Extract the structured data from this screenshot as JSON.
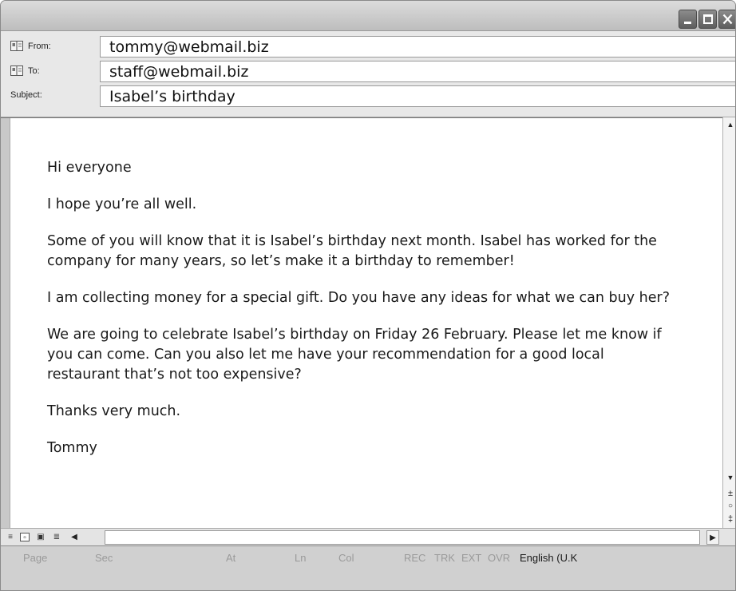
{
  "header": {
    "from_label": "From:",
    "from_value": "tommy@webmail.biz",
    "to_label": "To:",
    "to_value": "staff@webmail.biz",
    "subject_label": "Subject:",
    "subject_value": "Isabel’s birthday"
  },
  "message": {
    "paragraphs": [
      "Hi everyone",
      "I hope you’re all well.",
      "Some of you will know that it is Isabel’s birthday next month. Isabel has worked for the company for many years, so let’s make it a birthday to remember!",
      "I am collecting money for a special gift. Do you have any ideas for what we can buy her?",
      "We are going to celebrate Isabel’s birthday on Friday 26 February. Please let me know if you can come. Can you also let me have your recommendation for a good local restaurant that’s not too expensive?",
      "Thanks very much.",
      "Tommy"
    ]
  },
  "statusbar": {
    "page": "Page",
    "sec": "Sec",
    "at": "At",
    "ln": "Ln",
    "col": "Col",
    "rec": "REC",
    "trk": "TRK",
    "ext": "EXT",
    "ovr": "OVR",
    "language": "English (U.K"
  },
  "icons": {
    "address_book": "address-book-icon",
    "minimize": "minimize-icon",
    "maximize": "maximize-icon",
    "close": "close-icon"
  }
}
